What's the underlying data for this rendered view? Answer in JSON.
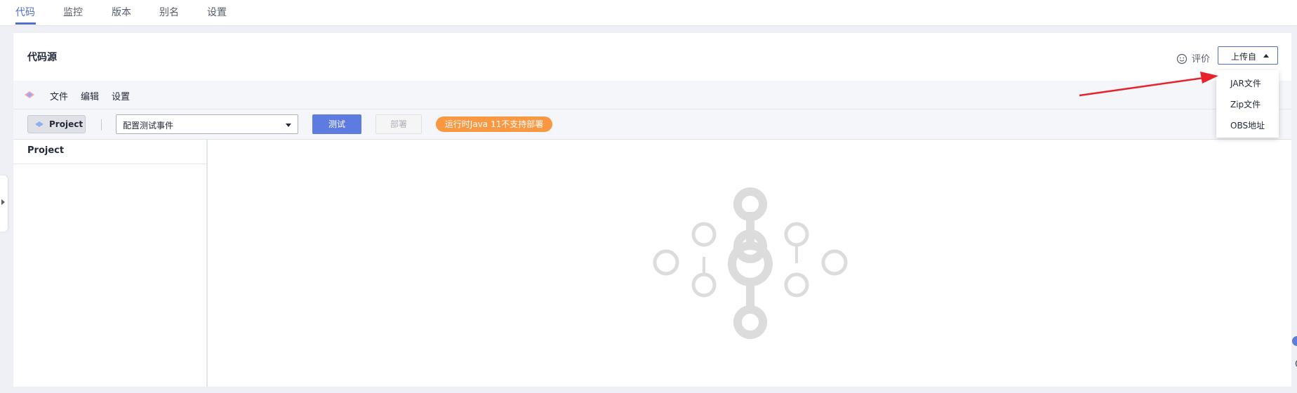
{
  "nav": {
    "tabs": [
      "代码",
      "监控",
      "版本",
      "别名",
      "设置"
    ],
    "active": 0
  },
  "card": {
    "title": "代码源",
    "rate_label": "评价",
    "upload_label": "上传自"
  },
  "ide": {
    "menu": [
      "文件",
      "编辑",
      "设置"
    ],
    "project_button": "Project",
    "test_event_placeholder": "配置测试事件",
    "test_button": "测试",
    "deploy_button": "部署",
    "runtime_badge": "运行时Java 11不支持部署",
    "left_pane_title": "Project"
  },
  "upload_menu": {
    "items": [
      "JAR文件",
      "Zip文件",
      "OBS地址"
    ]
  },
  "colors": {
    "accent": "#526ecc",
    "primary_button": "#5e7ce0",
    "badge": "#fa9841",
    "annotation_arrow": "#e8222b",
    "placeholder_icon": "#dcdcdc"
  }
}
